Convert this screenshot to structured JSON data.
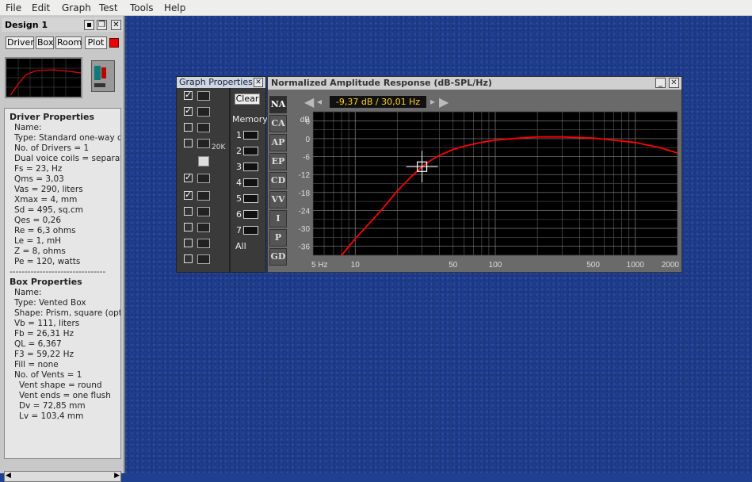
{
  "menu": [
    "File",
    "Edit",
    "Graph",
    "Test",
    "Tools",
    "Help"
  ],
  "design": {
    "title": "Design 1",
    "tabs": [
      "Driver",
      "Box",
      "Room",
      "Plot"
    ],
    "plot_color": "#ff0000"
  },
  "driver": {
    "heading": "Driver Properties",
    "lines": [
      "Name:",
      "Type: Standard one-way driv",
      "No. of Drivers = 1",
      "Dual voice coils = separate",
      "Fs =  23, Hz",
      "Qms =  3,03",
      "Vas =  290, liters",
      "Xmax =  4, mm",
      "Sd =  495, sq.cm",
      "Qes =  0,26",
      "Re =  6,3 ohms",
      "Le =  1, mH",
      "Z =  8, ohms",
      "Pe =  120, watts"
    ],
    "separator": "--------------------------------"
  },
  "box": {
    "heading": "Box Properties",
    "lines": [
      "Name:",
      "Type: Vented Box",
      "Shape: Prism, square (optimu",
      "Vb =  111, liters",
      "Fb =  26,31 Hz",
      "QL =  6,367",
      "F3 =  59,22 Hz",
      "Fill = none",
      "No. of Vents = 1"
    ],
    "vent_lines": [
      "Vent shape = round",
      "Vent ends = one flush",
      "Dv =  72,85 mm",
      "Lv =  103,4 mm"
    ]
  },
  "graph_props": {
    "title": "Graph Properties",
    "clear": "Clear",
    "memory": "Memory",
    "memory_slots": [
      "1",
      "2",
      "3",
      "4",
      "5",
      "6",
      "7"
    ],
    "all": "All",
    "icon_20k": "20K",
    "checkboxes": [
      true,
      true,
      false,
      false,
      true,
      true,
      false,
      false,
      false,
      false
    ]
  },
  "na_window": {
    "title": "Normalized Amplitude Response (dB-SPL/Hz)",
    "readout": "-9,37 dB / 30,01 Hz",
    "tabs": [
      "NA",
      "CA",
      "AP",
      "EP",
      "CD",
      "VV",
      "I",
      "P",
      "GD"
    ],
    "active_tab": "NA"
  },
  "chart_data": {
    "type": "line",
    "title": "Normalized Amplitude Response (dB-SPL/Hz)",
    "xlabel": "Hz",
    "ylabel": "dB",
    "xscale": "log",
    "xlim": [
      5,
      2000
    ],
    "ylim": [
      -39,
      9
    ],
    "x_ticks": [
      "5 Hz",
      "10",
      "50",
      "100",
      "500",
      "1000",
      "2000"
    ],
    "x_tick_values": [
      5,
      10,
      50,
      100,
      500,
      1000,
      2000
    ],
    "y_ticks": [
      "6",
      "0",
      "-6",
      "-12",
      "-18",
      "-24",
      "-30",
      "-36"
    ],
    "y_tick_values": [
      6,
      0,
      -6,
      -12,
      -18,
      -24,
      -30,
      -36
    ],
    "grid": true,
    "series": [
      {
        "color": "#ff0000",
        "x": [
          8,
          10,
          15,
          20,
          25,
          30,
          35,
          40,
          50,
          60,
          80,
          100,
          150,
          200,
          300,
          500,
          700,
          1000,
          1500,
          2000
        ],
        "y": [
          -39,
          -33.5,
          -24.5,
          -17.5,
          -12.8,
          -9.37,
          -7.1,
          -5.6,
          -3.6,
          -2.5,
          -1.2,
          -0.5,
          0.2,
          0.6,
          0.6,
          0.2,
          -0.5,
          -1.3,
          -3,
          -4.8
        ]
      }
    ],
    "cursor": {
      "x": 30.01,
      "y": -9.37
    }
  }
}
